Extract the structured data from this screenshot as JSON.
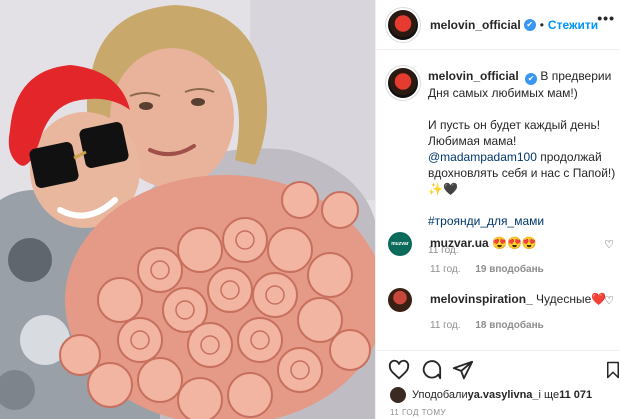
{
  "photo": {
    "alt": "",
    "icon": "photo-of-two-people-with-roses"
  },
  "header": {
    "username": "melovin_official",
    "verified": "✔",
    "separator": "•",
    "follow_label": "Стежити",
    "more_icon": "•••"
  },
  "caption": {
    "username": "melovin_official",
    "line1": "В предверии Дня самых любимых мам!)",
    "line2": "И пусть он будет каждый день! Любимая мама! ",
    "mention": "@madampadam100",
    "line3": " продолжай вдохновлять себя и нас с Папой!) ✨🖤",
    "hashtag": "#троянди_для_мами",
    "time": "11 год."
  },
  "comments": [
    {
      "username": "muzvar.ua",
      "text": "😍😍😍",
      "time": "11 год.",
      "likes": "19 вподобань",
      "avatar_text": "muzvar"
    },
    {
      "username": "melovinspiration_",
      "text": "Чудесные❤️",
      "time": "11 год.",
      "likes": "18 вподобань"
    }
  ],
  "likes": {
    "prefix": "Уподобали ",
    "user": "ya.vasylivna_",
    "middle": " і ще ",
    "count": "11 071"
  },
  "posted_ago": "11 ГОД ТОМУ",
  "colors": {
    "link": "#0095f6",
    "verified": "#3897f0",
    "muted": "#8e8e8e",
    "text": "#262626"
  }
}
